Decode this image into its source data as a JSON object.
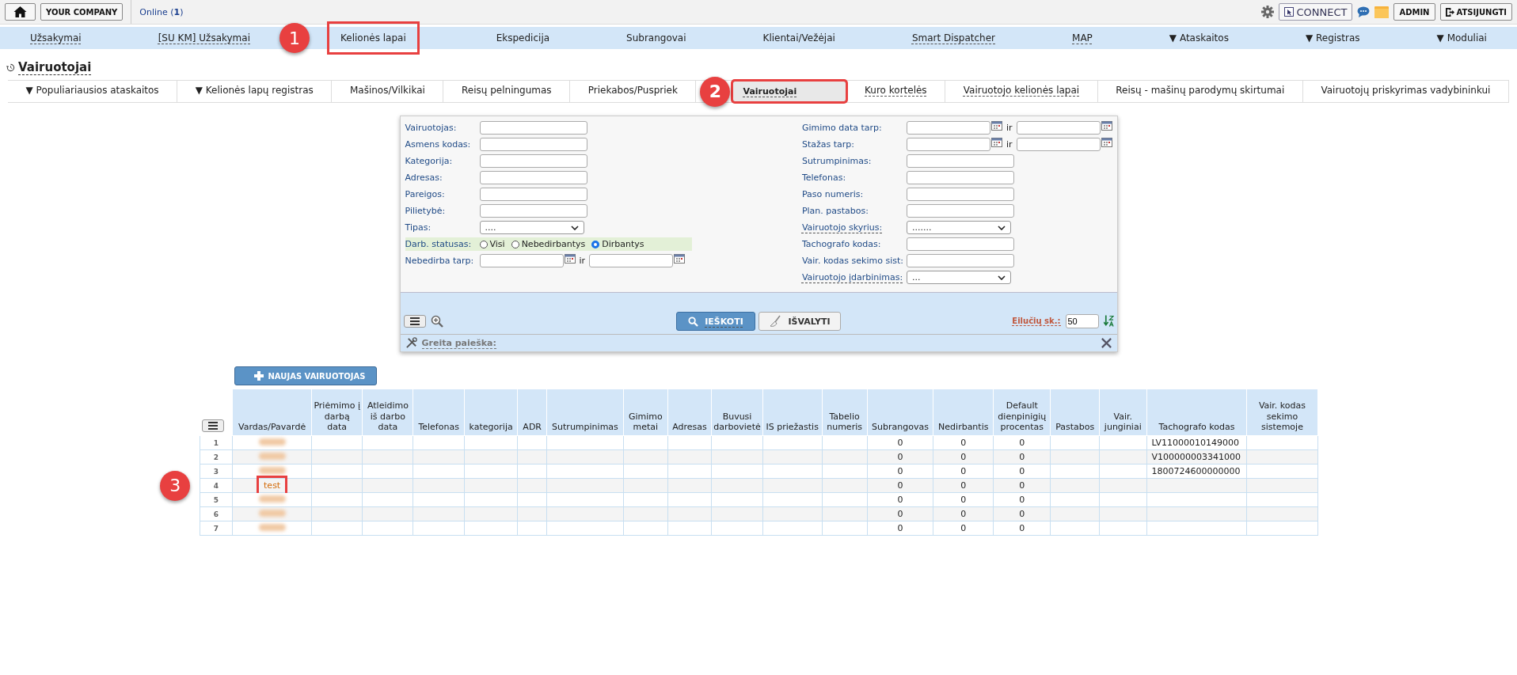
{
  "top_bar": {
    "company_button": "YOUR COMPANY",
    "online": "Online (**1**)",
    "connect_button": "CONNECT",
    "admin_button": "ADMIN",
    "logout_button": "ATSIJUNGTI"
  },
  "main_menu": [
    {
      "label": "Užsakymai",
      "underlined": true
    },
    {
      "label": "[SU KM] Užsakymai",
      "underlined": true
    },
    {
      "label": "Kelionės lapai",
      "underlined": false,
      "callout": "1"
    },
    {
      "label": "Ekspedicija",
      "underlined": false
    },
    {
      "label": "Subrangovai",
      "underlined": false
    },
    {
      "label": "Klientai/Vežėjai",
      "underlined": false
    },
    {
      "label": "Smart Dispatcher",
      "underlined": true
    },
    {
      "label": "MAP",
      "underlined": true
    },
    {
      "label": "▼ Ataskaitos",
      "underlined": false
    },
    {
      "label": "▼ Registras",
      "underlined": false
    },
    {
      "label": "▼ Moduliai",
      "underlined": false
    }
  ],
  "page_title": "Vairuotojai",
  "tabs": [
    {
      "label": "▼ Populiariausios ataskaitos",
      "selected": false,
      "underlined": false
    },
    {
      "label": "▼ Kelionės lapų registras",
      "selected": false,
      "underlined": false
    },
    {
      "label": "Mašinos/Vilkikai",
      "selected": false,
      "underlined": false
    },
    {
      "label": "Reisų pelningumas",
      "selected": false,
      "underlined": false
    },
    {
      "label": "Priekabos/Puspriek",
      "selected": false,
      "underlined": false
    },
    {
      "label": "Vairuotojai",
      "selected": true,
      "underlined": true,
      "callout": "2"
    },
    {
      "label": "Kuro kortelės",
      "selected": false,
      "underlined": true
    },
    {
      "label": "Vairuotojo kelionės lapai",
      "selected": false,
      "underlined": true
    },
    {
      "label": "Reisų - mašinų parodymų skirtumai",
      "selected": false,
      "underlined": false
    },
    {
      "label": "Vairuotojų priskyrimas vadybininkui",
      "selected": false,
      "underlined": false
    }
  ],
  "search_form": {
    "left_fields": [
      {
        "kind": "text",
        "label": "Vairuotojas:"
      },
      {
        "kind": "text",
        "label": "Asmens kodas:"
      },
      {
        "kind": "text",
        "label": "Kategorija:"
      },
      {
        "kind": "text",
        "label": "Adresas:"
      },
      {
        "kind": "text",
        "label": "Pareigos:"
      },
      {
        "kind": "text",
        "label": "Pilietybė:"
      },
      {
        "kind": "select",
        "label": "Tipas:",
        "value": "...."
      },
      {
        "kind": "radio",
        "label": "Darb. statusas:",
        "options": [
          {
            "label": "Visi",
            "selected": false
          },
          {
            "label": "Nebedirbantys",
            "selected": false
          },
          {
            "label": "Dirbantys",
            "selected": true
          }
        ]
      },
      {
        "kind": "daterange",
        "label": "Nebedirba tarp:",
        "joiner": "ir"
      }
    ],
    "right_fields": [
      {
        "kind": "daterange",
        "label": "Gimimo data tarp:",
        "joiner": "ir"
      },
      {
        "kind": "daterange",
        "label": "Stažas tarp:",
        "joiner": "ir"
      },
      {
        "kind": "text",
        "label": "Sutrumpinimas:"
      },
      {
        "kind": "text",
        "label": "Telefonas:"
      },
      {
        "kind": "text",
        "label": "Paso numeris:"
      },
      {
        "kind": "text",
        "label": "Plan. pastabos:"
      },
      {
        "kind": "select",
        "label": "Vairuotojo skyrius:",
        "value": ".......",
        "underlined": true
      },
      {
        "kind": "text",
        "label": "Tachografo kodas:"
      },
      {
        "kind": "text",
        "label": "Vair. kodas sekimo sist:"
      },
      {
        "kind": "select",
        "label": "Vairuotojo įdarbinimas:",
        "value": "...",
        "underlined": true
      }
    ],
    "search_button": "IEŠKOTI",
    "clear_button": "IŠVALYTI",
    "rows_label": "Eilučių sk.:",
    "rows_value": "50",
    "quick_search": "Greita paieška:"
  },
  "new_button": "NAUJAS VAIRUOTOJAS",
  "table": {
    "columns": [
      "Vardas/Pavardė",
      "Priėmimo į darbą data",
      "Atleidimo iš darbo data",
      "Telefonas",
      "kategorija",
      "ADR",
      "Sutrumpinimas",
      "Gimimo metai",
      "Adresas",
      "Buvusi darbovietė",
      "IS priežastis",
      "Tabelio numeris",
      "Subrangovas",
      "Nedirbantis",
      "Default dienpinigių procentas",
      "Pastabos",
      "Vair. junginiai",
      "Tachografo kodas",
      "Vair. kodas sekimo sistemoje"
    ],
    "rows": [
      {
        "number": "1",
        "redacted": true,
        "subrangovas": "0",
        "nedirbantis": "0",
        "default_percent": "0",
        "tachograph_code": "LV11000010149000"
      },
      {
        "number": "2",
        "redacted": true,
        "subrangovas": "0",
        "nedirbantis": "0",
        "default_percent": "0",
        "tachograph_code": "V100000003341000"
      },
      {
        "number": "3",
        "redacted": true,
        "subrangovas": "0",
        "nedirbantis": "0",
        "default_percent": "0",
        "tachograph_code": "1800724600000000"
      },
      {
        "number": "4",
        "redacted": false,
        "name": "test",
        "callout": "3",
        "subrangovas": "0",
        "nedirbantis": "0",
        "default_percent": "0"
      },
      {
        "number": "5",
        "redacted": true,
        "subrangovas": "0",
        "nedirbantis": "0",
        "default_percent": "0"
      },
      {
        "number": "6",
        "redacted": true,
        "subrangovas": "0",
        "nedirbantis": "0",
        "default_percent": "0"
      },
      {
        "number": "7",
        "redacted": true,
        "subrangovas": "0",
        "nedirbantis": "0",
        "default_percent": "0"
      }
    ]
  }
}
